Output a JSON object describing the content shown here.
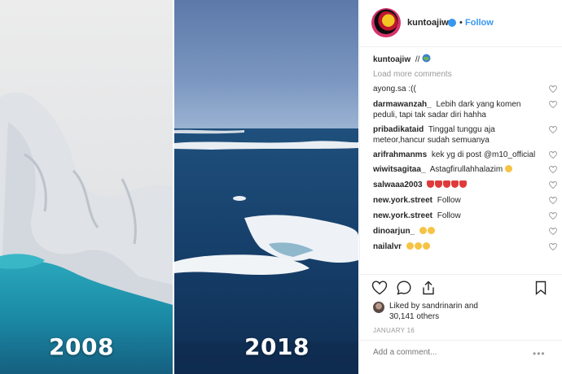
{
  "photo": {
    "left_year": "2008",
    "right_year": "2018"
  },
  "header": {
    "username": "kuntoajiw",
    "separator": "•",
    "follow_label": "Follow"
  },
  "caption": {
    "username": "kuntoajiw",
    "text": "//"
  },
  "load_more_label": "Load more comments",
  "comments": [
    {
      "user": "ayong.sa",
      "text": ":(("
    },
    {
      "user": "darmawanzah_",
      "text": "Lebih dark yang komen peduli, tapi tak sadar diri hahha"
    },
    {
      "user": "pribadikataid",
      "text": "Tinggal tunggu aja meteor,hancur sudah semuanya"
    },
    {
      "user": "arifrahmanms",
      "text": "kek yg di post @m10_official"
    },
    {
      "user": "wiwitsagitaa_",
      "text": "Astagfirullahhalazim"
    },
    {
      "user": "salwaaa2003",
      "text": ""
    },
    {
      "user": "new.york.street",
      "text": "Follow"
    },
    {
      "user": "new.york.street",
      "text": "Follow"
    },
    {
      "user": "dinoarjun_",
      "text": ""
    },
    {
      "user": "nailalvr",
      "text": ""
    }
  ],
  "likes": {
    "text_line1": "Liked by sandrinarin and",
    "text_line2": "30,141 others"
  },
  "date": "JANUARY 16",
  "add_comment_placeholder": "Add a comment...",
  "more_label": "•••",
  "colors": {
    "accent": "#3897f0",
    "text": "#262626",
    "muted": "#999999"
  }
}
